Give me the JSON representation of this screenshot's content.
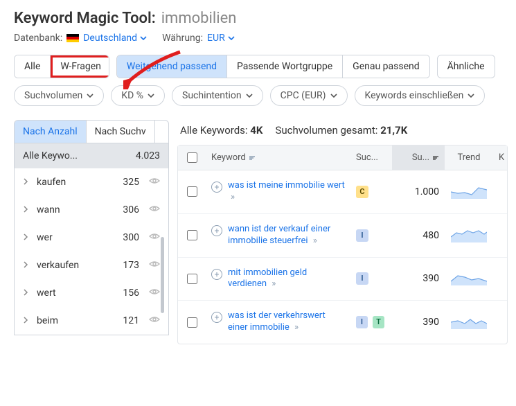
{
  "header": {
    "title": "Keyword Magic Tool:",
    "keyword": "immobilien",
    "database_label": "Datenbank:",
    "database_value": "Deutschland",
    "currency_label": "Währung:",
    "currency_value": "EUR"
  },
  "match_tabs": {
    "group1": [
      "Alle",
      "W-Fragen"
    ],
    "group2": [
      "Weitgehend passend",
      "Passende Wortgruppe",
      "Genau passend"
    ],
    "similar": "Ähnliche"
  },
  "filters": [
    "Suchvolumen",
    "KD %",
    "Suchintention",
    "CPC (EUR)",
    "Keywords einschließen"
  ],
  "sidebar": {
    "tabs": [
      "Nach Anzahl",
      "Nach Suchv"
    ],
    "header": {
      "label": "Alle Keywo...",
      "count": "4.023"
    },
    "items": [
      {
        "kw": "kaufen",
        "count": "325"
      },
      {
        "kw": "wann",
        "count": "306"
      },
      {
        "kw": "wer",
        "count": "300"
      },
      {
        "kw": "verkaufen",
        "count": "173"
      },
      {
        "kw": "wert",
        "count": "156"
      },
      {
        "kw": "beim",
        "count": "121"
      }
    ]
  },
  "stats": {
    "all_label": "Alle Keywords:",
    "all_value": "4K",
    "vol_label": "Suchvolumen gesamt:",
    "vol_value": "21,7K"
  },
  "columns": {
    "keyword": "Keyword",
    "intent": "Suc...",
    "volume": "Su...",
    "trend": "Trend",
    "k": "K"
  },
  "rows": [
    {
      "kw": "was ist meine immobilie wert",
      "intents": [
        "C"
      ],
      "volume": "1.000"
    },
    {
      "kw": "wann ist der verkauf einer immobilie steuerfrei",
      "intents": [
        "I"
      ],
      "volume": "480"
    },
    {
      "kw": "mit immobilien geld verdienen",
      "intents": [
        "I"
      ],
      "volume": "390"
    },
    {
      "kw": "was ist der verkehrswert einer immobilie",
      "intents": [
        "I",
        "T"
      ],
      "volume": "390"
    }
  ]
}
